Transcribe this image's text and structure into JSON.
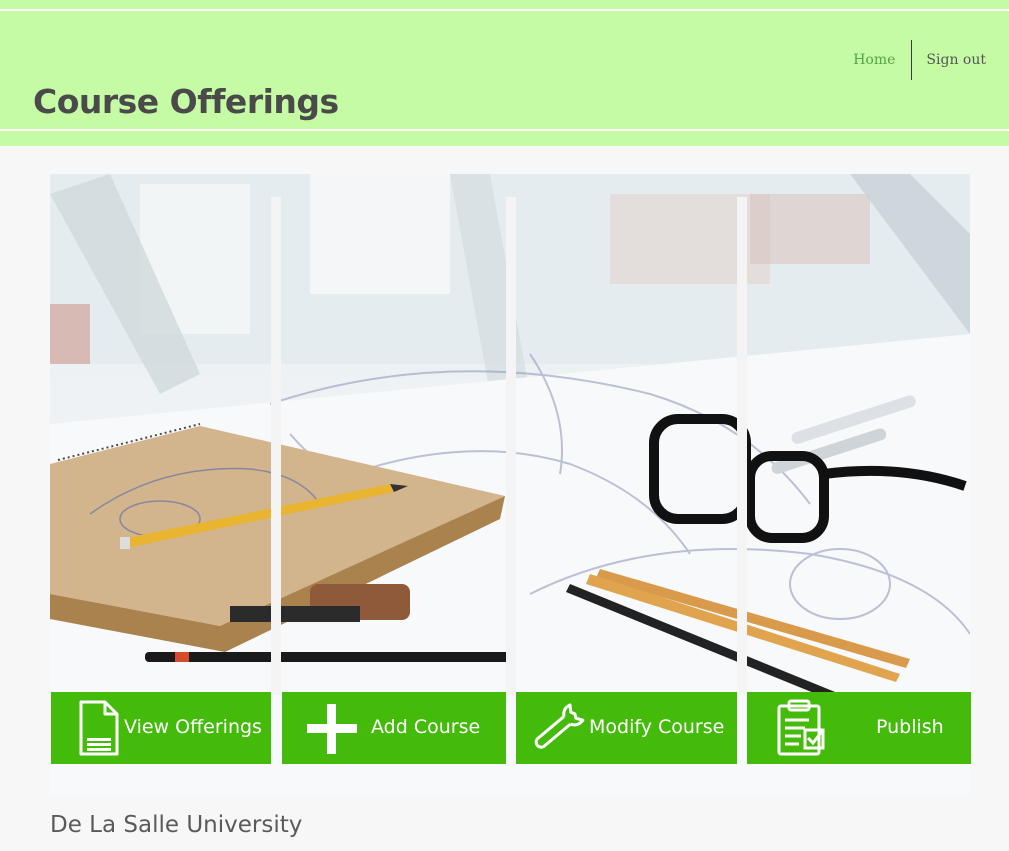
{
  "header": {
    "title": "Course Offerings",
    "nav": {
      "home": "Home",
      "sign_out": "Sign out"
    }
  },
  "hero": {
    "icon": "sketch-desk-photo"
  },
  "tiles": [
    {
      "label": "View Offerings",
      "icon": "document-icon"
    },
    {
      "label": "Add Course",
      "icon": "plus-icon"
    },
    {
      "label": "Modify Course",
      "icon": "wrench-icon"
    },
    {
      "label": "Publish",
      "icon": "clipboard-check-icon"
    }
  ],
  "footer": {
    "university": "De La Salle University"
  },
  "colors": {
    "header_bg": "#c6fba5",
    "tile_bg": "#44bb0a",
    "nav_home": "#55a544",
    "page_bg": "#f7f7f7"
  }
}
